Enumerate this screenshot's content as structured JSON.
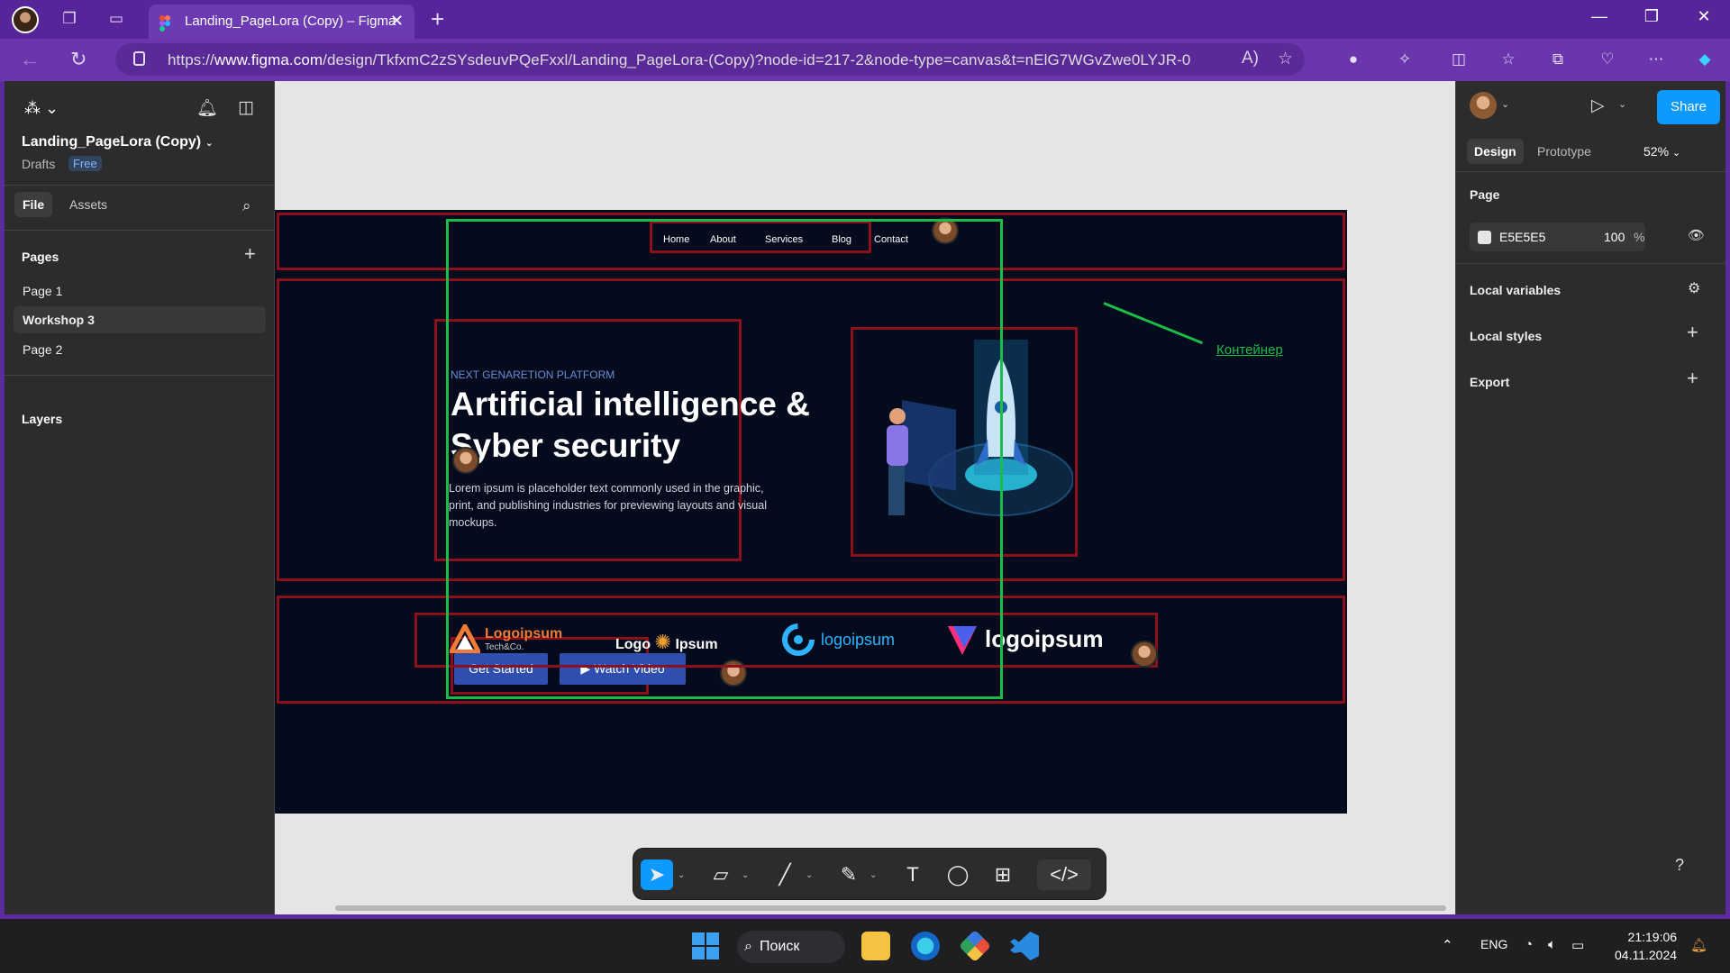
{
  "browser": {
    "tab_title": "Landing_PageLora (Copy) – Figma",
    "url_prefix": "https://",
    "url_domain": "www.figma.com",
    "url_rest": "/design/TkfxmC2zSYsdeuvPQeFxxl/Landing_PageLora-(Copy)?node-id=217-2&node-type=canvas&t=nElG7WGvZwe0LYJR-0"
  },
  "left_panel": {
    "file_name": "Landing_PageLora (Copy)",
    "location": "Drafts",
    "plan_badge": "Free",
    "tabs": [
      "File",
      "Assets"
    ],
    "pages_title": "Pages",
    "pages": [
      {
        "label": "Page 1",
        "selected": false
      },
      {
        "label": "Workshop 3",
        "selected": true
      },
      {
        "label": "Page 2",
        "selected": false
      }
    ],
    "layers_title": "Layers"
  },
  "right_panel": {
    "share_label": "Share",
    "tabs": [
      "Design",
      "Prototype"
    ],
    "zoom": "52%",
    "page_title": "Page",
    "page_color_hex": "E5E5E5",
    "page_opacity": "100",
    "page_opacity_unit": "%",
    "sections": [
      "Local variables",
      "Local styles",
      "Export"
    ],
    "help": "?"
  },
  "canvas": {
    "nav": [
      "Home",
      "About",
      "Services",
      "Blog",
      "Contact"
    ],
    "eyebrow": "NEXT GENARETION PLATFORM",
    "headline": "Artificial intelligence & Syber security",
    "paragraph": "Lorem ipsum is placeholder text commonly used in the graphic, print, and publishing industries for previewing layouts and visual mockups.",
    "btn_primary": "Get Started",
    "btn_secondary": "Watch Video",
    "annotation": "Контейнер",
    "logos": [
      {
        "main": "Logoipsum",
        "sub": "Tech&Co."
      },
      {
        "main": "Logo",
        "sub": "Ipsum"
      },
      {
        "main": "logoipsum"
      },
      {
        "main": "logoipsum"
      }
    ]
  },
  "taskbar": {
    "search": "Поиск",
    "lang": "ENG",
    "time": "21:19:06",
    "date": "04.11.2024"
  },
  "colors": {
    "browser_purple": "#56259a",
    "figma_panel": "#2c2c2c",
    "canvas_bg": "#e5e5e5",
    "frame_bg": "#040b1c",
    "selection_red": "#8c0f1c",
    "container_green": "#1bbd4a",
    "accent_blue": "#0d99ff",
    "button_blue": "#2f4fb0"
  }
}
